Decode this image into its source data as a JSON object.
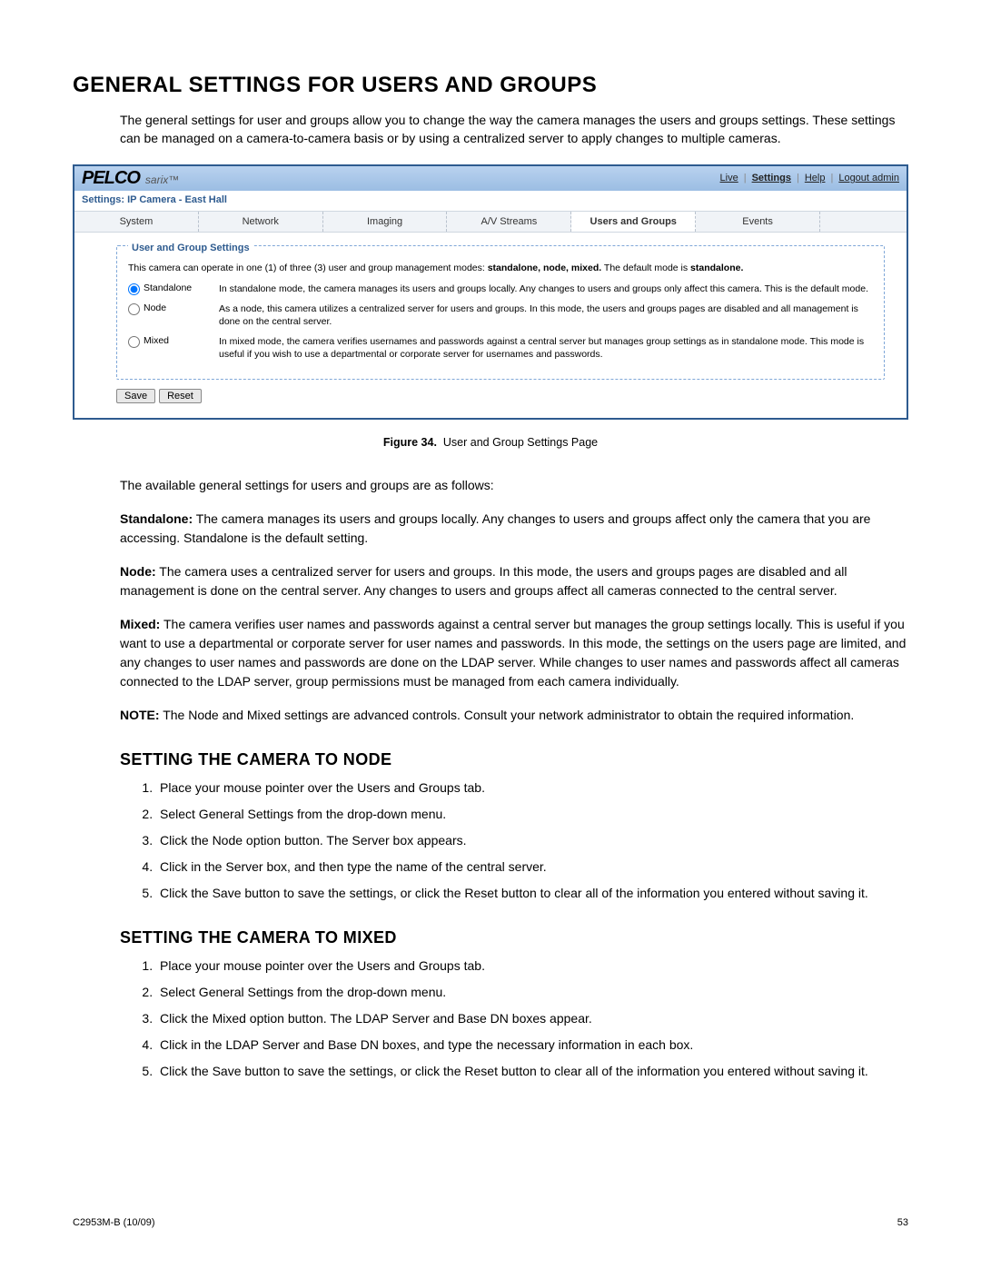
{
  "title": "GENERAL SETTINGS FOR USERS AND GROUPS",
  "intro": "The general settings for user and groups allow you to change the way the camera manages the users and groups settings. These settings can be managed on a camera-to-camera basis or by using a centralized server to apply changes to multiple cameras.",
  "screenshot": {
    "logo_main": "PELCO",
    "logo_sub": "sarix™",
    "links": {
      "live": "Live",
      "settings": "Settings",
      "help": "Help",
      "logout": "Logout admin"
    },
    "subhead": "Settings: IP Camera - East Hall",
    "tabs": [
      "System",
      "Network",
      "Imaging",
      "A/V Streams",
      "Users and Groups",
      "Events"
    ],
    "active_tab_index": 4,
    "fieldset_legend": "User and Group Settings",
    "mode_intro_pre": "This camera can operate in one (1) of three (3) user and group management modes: ",
    "mode_intro_bold": "standalone, node, mixed.",
    "mode_intro_post": " The default mode is ",
    "mode_intro_bold2": "standalone.",
    "options": [
      {
        "label": "Standalone",
        "desc": "In standalone mode, the camera manages its users and groups locally. Any changes to users and groups only affect this camera. This is the default mode.",
        "checked": true
      },
      {
        "label": "Node",
        "desc": "As a node, this camera utilizes a centralized server for users and groups. In this mode, the users and groups pages are disabled and all management is done on the central server.",
        "checked": false
      },
      {
        "label": "Mixed",
        "desc": "In mixed mode, the camera verifies usernames and passwords against a central server but manages group settings as in standalone mode. This mode is useful if you wish to use a departmental or corporate server for usernames and passwords.",
        "checked": false
      }
    ],
    "buttons": {
      "save": "Save",
      "reset": "Reset"
    }
  },
  "figcap_prefix": "Figure 34.",
  "figcap_text": "User and Group Settings Page",
  "para_avail": "The available general settings for users and groups are as follows:",
  "defs": {
    "standalone_label": "Standalone:",
    "standalone_text": " The camera manages its users and groups locally. Any changes to users and groups affect only the camera that you are accessing. Standalone is the default setting.",
    "node_label": "Node:",
    "node_text": " The camera uses a centralized server for users and groups. In this mode, the users and groups pages are disabled and all management is done on the central server. Any changes to users and groups affect all cameras connected to the central server.",
    "mixed_label": "Mixed:",
    "mixed_text": " The camera verifies user names and passwords against a central server but manages the group settings locally. This is useful if you want to use a departmental or corporate server for user names and passwords. In this mode, the settings on the users page are limited, and any changes to user names and passwords are done on the LDAP server. While changes to user names and passwords affect all cameras connected to the LDAP server, group permissions must be managed from each camera individually.",
    "note_label": "NOTE:",
    "note_text": " The Node and Mixed settings are advanced controls. Consult your network administrator to obtain the required information."
  },
  "h2_node": "SETTING THE CAMERA TO NODE",
  "steps_node": [
    "Place your mouse pointer over the Users and Groups tab.",
    "Select General Settings from the drop-down menu.",
    "Click the Node option button. The Server box appears.",
    "Click in the Server box, and then type the name of the central server.",
    "Click the Save button to save the settings, or click the Reset button to clear all of the information you entered without saving it."
  ],
  "h2_mixed": "SETTING THE CAMERA TO MIXED",
  "steps_mixed": [
    "Place your mouse pointer over the Users and Groups tab.",
    "Select General Settings from the drop-down menu.",
    "Click the Mixed option button. The LDAP Server and Base DN boxes appear.",
    "Click in the LDAP Server and Base DN boxes, and type the necessary information in each box.",
    "Click the Save button to save the settings, or click the Reset button to clear all of the information you entered without saving it."
  ],
  "footer_left": "C2953M-B (10/09)",
  "footer_right": "53"
}
